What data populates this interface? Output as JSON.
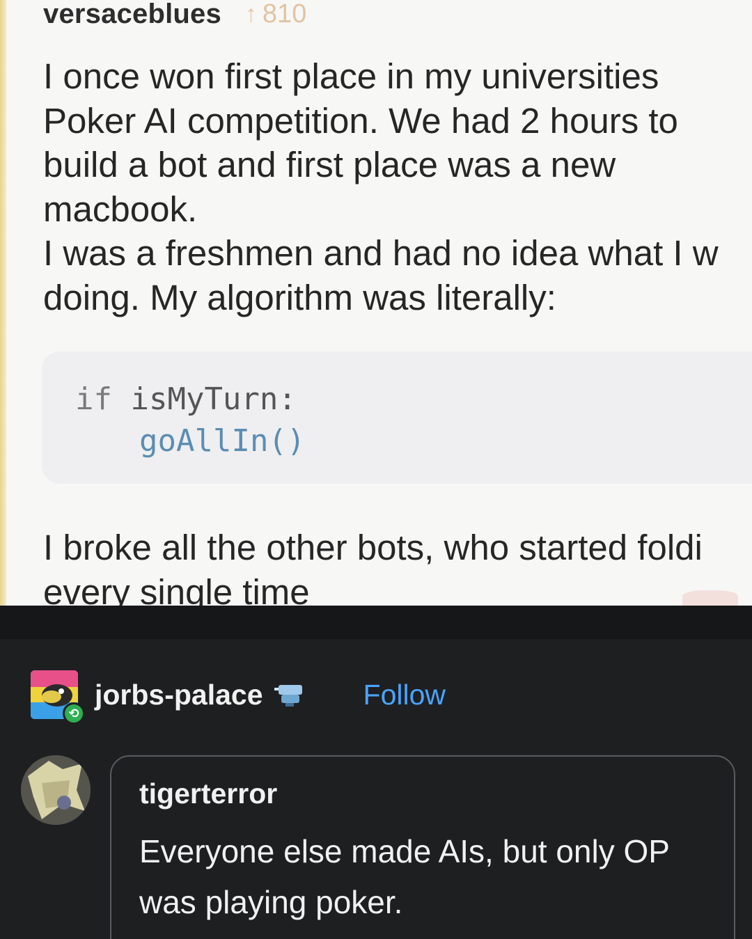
{
  "original_post": {
    "username": "versaceblues",
    "upvote_icon": "arrow-up-icon",
    "upvotes": "810",
    "paragraph_1": [
      "I once won first place in my universities",
      "Poker AI competition. We had 2 hours to",
      "build a bot and first place was a new",
      "macbook.",
      "I was a freshmen and had no idea what I w",
      "doing. My algorithm was literally:"
    ],
    "code": {
      "keyword": "if",
      "condition": "isMyTurn:",
      "action": "goAllIn()"
    },
    "paragraph_2": [
      "I broke all the other bots, who started foldi",
      "every single time"
    ]
  },
  "reblog": {
    "username": "jorbs-palace",
    "badge_icon": "sticker-badge-icon",
    "reblog_icon": "reblog-icon",
    "follow_label": "Follow",
    "accent_color": "#4aa3ff"
  },
  "reply": {
    "username": "tigerterror",
    "text": "Everyone else made AIs, but only OP was playing poker."
  },
  "colors": {
    "light_bg": "#f7f7f6",
    "dark_bg": "#1e1f21",
    "reblog_green": "#2fae52"
  }
}
